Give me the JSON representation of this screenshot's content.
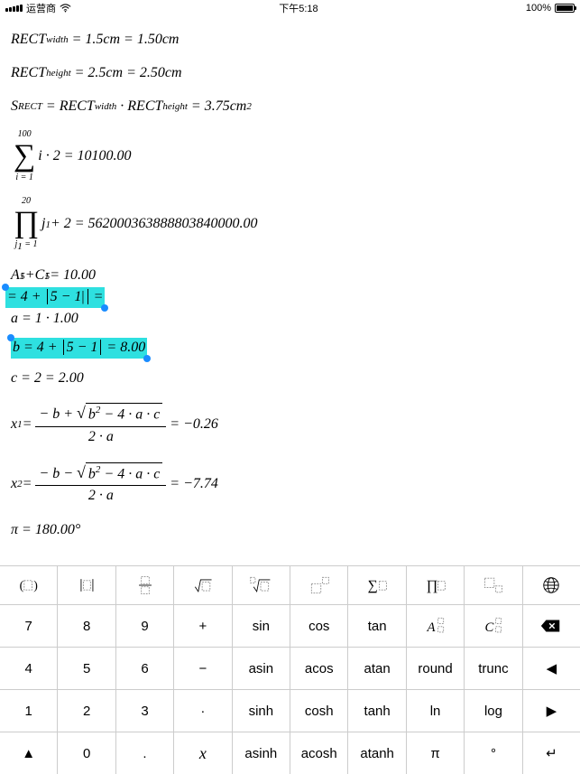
{
  "status": {
    "carrier": "运营商",
    "time": "下午5:18",
    "battery": "100%"
  },
  "lines": {
    "l1": {
      "var": "RECT",
      "sub": "width",
      "expr": "= 1.5cm = 1.50cm"
    },
    "l2": {
      "var": "RECT",
      "sub": "height",
      "expr": "= 2.5cm = 2.50cm"
    },
    "l3": {
      "v": "S",
      "vs": "RECT",
      "eq": "=",
      "a": "RECT",
      "as": "width",
      "dot": "·",
      "b": "RECT",
      "bs": "height",
      "res": "= 3.75cm",
      "exp": "2"
    },
    "l4": {
      "up": "100",
      "dn": "i = 1",
      "body": " i · 2 = 10100.00"
    },
    "l5": {
      "up": "20",
      "dnv": "j",
      "dns": "1",
      "dnr": " = 1",
      "bv": "j",
      "bs": "1",
      "body": " + 2 = 562000363888803840000.00"
    },
    "l6": {
      "a": "A",
      "as1": "1",
      "as2": "5",
      "p": " + ",
      "c": "C",
      "cs1": "1",
      "cs2": "5",
      "r": " = 10.00"
    },
    "l7": {
      "pre": "= 4 + ",
      "abs": "5 − 1",
      "cursor": "|",
      "post": " ="
    },
    "l8": "a = 1 · 1.00",
    "l9": {
      "lhs": "b = 4 + ",
      "abs": "5 − 1",
      "rhs": " = 8.00"
    },
    "l10": "c = 2 = 2.00",
    "l11": {
      "v": "x",
      "vs": "1",
      "eq": " = ",
      "num_pre": "− b + ",
      "rad": "b",
      "rad_sup": "2",
      "rad_post": " − 4 · a · c",
      "den": "2 · a",
      "res": " = −0.26"
    },
    "l12": {
      "v": "x",
      "vs": "2",
      "eq": " = ",
      "num_pre": "− b − ",
      "rad": "b",
      "rad_sup": "2",
      "rad_post": " − 4 · a · c",
      "den": "2 · a",
      "res": " = −7.74"
    },
    "l13": "π = 180.00°"
  },
  "keys": {
    "r0": [
      "parens",
      "abs",
      "frac",
      "sqrt",
      "nroot",
      "power",
      "sum",
      "prod",
      "subscript",
      "globe"
    ],
    "r1": [
      "7",
      "8",
      "9",
      "+",
      "sin",
      "cos",
      "tan",
      "A",
      "C",
      "backspace"
    ],
    "r2": [
      "4",
      "5",
      "6",
      "−",
      "asin",
      "acos",
      "atan",
      "round",
      "trunc",
      "◀"
    ],
    "r3": [
      "1",
      "2",
      "3",
      "·",
      "sinh",
      "cosh",
      "tanh",
      "ln",
      "log",
      "▶"
    ],
    "r4": [
      "▲",
      "0",
      ".",
      "x",
      "asinh",
      "acosh",
      "atanh",
      "π",
      "°",
      "↵"
    ]
  }
}
